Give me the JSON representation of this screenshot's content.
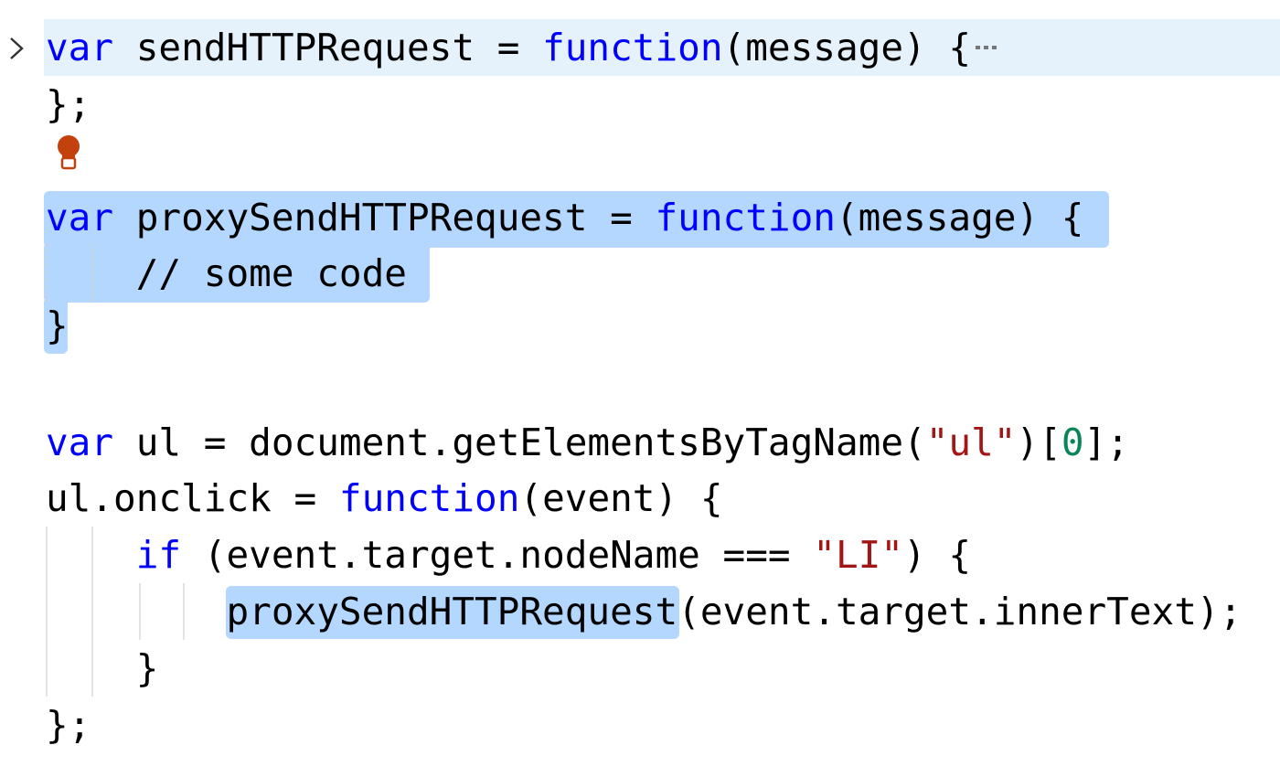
{
  "lines": [
    {
      "segments": [
        {
          "t": "var",
          "c": "kw"
        },
        {
          "t": " sendHTTPRequest = ",
          "c": ""
        },
        {
          "t": "function",
          "c": "kw"
        },
        {
          "t": "(message) {",
          "c": ""
        }
      ]
    },
    {
      "segments": [
        {
          "t": "};",
          "c": ""
        }
      ]
    },
    {
      "segments": []
    },
    {
      "segments": [
        {
          "t": "var",
          "c": "kw"
        },
        {
          "t": " proxySendHTTPRequest = ",
          "c": ""
        },
        {
          "t": "function",
          "c": "kw"
        },
        {
          "t": "(message) {",
          "c": ""
        }
      ]
    },
    {
      "segments": [
        {
          "t": "    // some code",
          "c": "cm"
        }
      ]
    },
    {
      "segments": [
        {
          "t": "}",
          "c": ""
        }
      ]
    },
    {
      "segments": []
    },
    {
      "segments": [
        {
          "t": "var",
          "c": "kw"
        },
        {
          "t": " ul = document.getElementsByTagName(",
          "c": ""
        },
        {
          "t": "\"ul\"",
          "c": "str"
        },
        {
          "t": ")[",
          "c": ""
        },
        {
          "t": "0",
          "c": "num"
        },
        {
          "t": "];",
          "c": ""
        }
      ]
    },
    {
      "segments": [
        {
          "t": "ul.onclick = ",
          "c": ""
        },
        {
          "t": "function",
          "c": "kw"
        },
        {
          "t": "(event) {",
          "c": ""
        }
      ]
    },
    {
      "segments": [
        {
          "t": "    ",
          "c": ""
        },
        {
          "t": "if",
          "c": "kw"
        },
        {
          "t": " (event.target.nodeName === ",
          "c": ""
        },
        {
          "t": "\"LI\"",
          "c": "str"
        },
        {
          "t": ") {",
          "c": ""
        }
      ]
    },
    {
      "segments": [
        {
          "t": "        proxySendHTTPRequest(event.target.innerText);",
          "c": ""
        }
      ]
    },
    {
      "segments": [
        {
          "t": "    }",
          "c": ""
        }
      ]
    },
    {
      "segments": [
        {
          "t": "};",
          "c": ""
        }
      ]
    }
  ],
  "colors": {
    "keyword": "#0000ff",
    "string": "#a31515",
    "number": "#098658",
    "selection": "#b3d7ff",
    "fold_highlight": "#e5f1fb",
    "lightbulb": "#c2410c"
  },
  "icons": {
    "fold": "chevron-right-icon",
    "collapsed": "ellipsis-icon",
    "code_action": "lightbulb-icon"
  }
}
